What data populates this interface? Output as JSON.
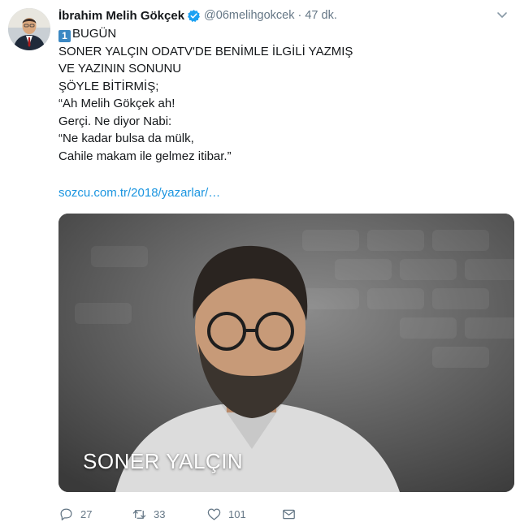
{
  "colors": {
    "link": "#1b95e0",
    "secondary_text": "#657786",
    "verified_badge": "#1da1f2",
    "keycap_badge": "#3b88c3"
  },
  "author": {
    "display_name": "İbrahim Melih Gökçek",
    "handle": "@06melihgokcek",
    "separator": "·",
    "time": "47 dk.",
    "verified_icon": "verified-badge-icon",
    "avatar": "profile photo"
  },
  "tweet": {
    "keycap": "1",
    "lines": [
      "BUGÜN",
      "SONER YALÇIN ODATV'DE BENİMLE İLGİLİ YAZMIŞ",
      "VE YAZININ SONUNU",
      "ŞÖYLE BİTİRMİŞ;",
      "“Ah Melih Gökçek ah!",
      "Gerçi. Ne diyor Nabi:",
      "“Ne kadar bulsa da mülk,",
      "Cahile makam ile gelmez itibar.”"
    ],
    "link": "sozcu.com.tr/2018/yazarlar/…"
  },
  "media": {
    "caption": "SONER YALÇIN"
  },
  "actions": {
    "replies": "27",
    "retweets": "33",
    "likes": "101",
    "reply_icon": "reply-icon",
    "retweet_icon": "retweet-icon",
    "like_icon": "heart-icon",
    "dm_icon": "envelope-icon"
  }
}
